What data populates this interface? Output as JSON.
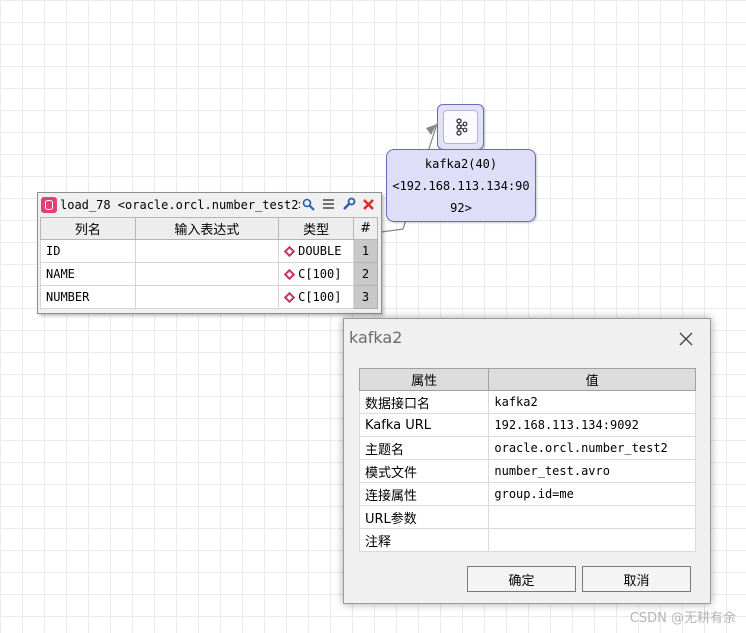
{
  "load_node": {
    "title": "load_78 <oracle.orcl.number_test2>",
    "columns": [
      "列名",
      "输入表达式",
      "类型",
      "#"
    ],
    "rows": [
      {
        "name": "ID",
        "expr": "",
        "type": "DOUBLE",
        "num": "1"
      },
      {
        "name": "NAME",
        "expr": "",
        "type": "C[100]",
        "num": "2"
      },
      {
        "name": "NUMBER",
        "expr": "",
        "type": "C[100]",
        "num": "3"
      }
    ]
  },
  "kafka_node": {
    "line1": "kafka2(40)",
    "line2": "<192.168.113.134:90",
    "line3": "92>"
  },
  "dialog": {
    "title": "kafka2",
    "headers": {
      "key": "属性",
      "value": "值"
    },
    "props": [
      {
        "key": "数据接口名",
        "value": "kafka2"
      },
      {
        "key": "Kafka URL",
        "value": "192.168.113.134:9092"
      },
      {
        "key": "主题名",
        "value": "oracle.orcl.number_test2"
      },
      {
        "key": "模式文件",
        "value": "number_test.avro"
      },
      {
        "key": "连接属性",
        "value": "group.id=me"
      },
      {
        "key": "URL参数",
        "value": ""
      },
      {
        "key": "注释",
        "value": ""
      }
    ],
    "ok_label": "确定",
    "cancel_label": "取消"
  },
  "watermark": "CSDN @无耕有余",
  "colors": {
    "node_fill": "#dedef8",
    "node_border": "#6a6ab8",
    "type_icon": "#e0407a"
  }
}
